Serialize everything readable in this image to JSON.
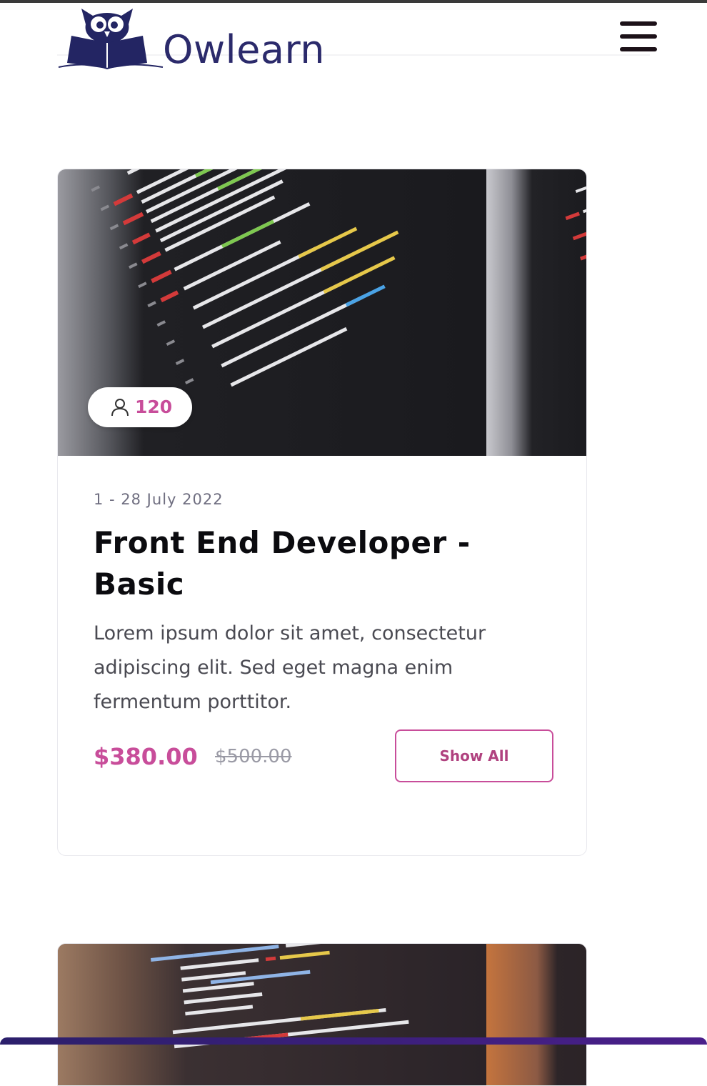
{
  "header": {
    "brand_name": "Owlearn",
    "menu_icon": "hamburger-menu-icon"
  },
  "courses": [
    {
      "students_icon": "user-icon",
      "students_count": "120",
      "date_range": "1 - 28 July 2022",
      "title": "Front End Developer - Basic",
      "description": "Lorem ipsum dolor sit amet, consectetur adipiscing elit. Sed eget magna enim fermentum porttitor.",
      "price": "$380.00",
      "old_price": "$500.00",
      "button_label": "Show All"
    }
  ],
  "colors": {
    "brand": "#2b2a6b",
    "accent": "#c84d9a",
    "title": "#0b0b0f",
    "muted": "#6f6e80"
  }
}
